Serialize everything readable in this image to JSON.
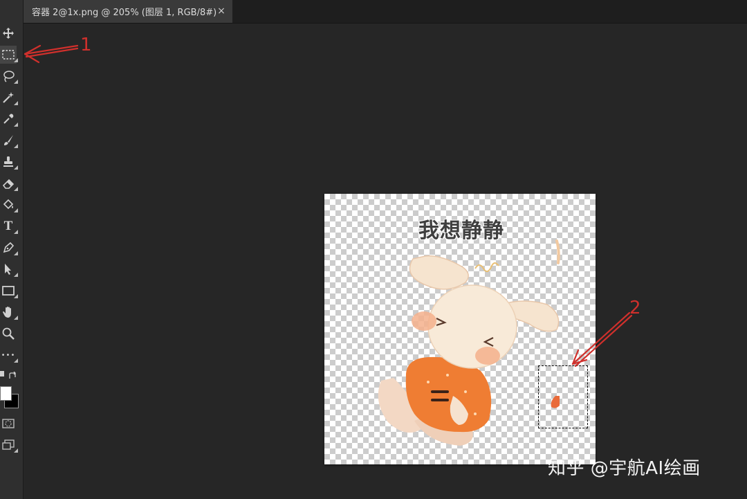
{
  "tab": {
    "title": "容器 2@1x.png @ 205% (图层 1, RGB/8#)",
    "close_glyph": "×"
  },
  "tools": [
    {
      "name": "move-tool",
      "icon": "move-icon"
    },
    {
      "name": "marquee-tool",
      "icon": "rectangular-marquee-icon"
    },
    {
      "name": "lasso-tool",
      "icon": "lasso-icon"
    },
    {
      "name": "magic-wand-tool",
      "icon": "magic-wand-icon"
    },
    {
      "name": "eyedropper-tool",
      "icon": "eyedropper-icon"
    },
    {
      "name": "brush-tool",
      "icon": "brush-icon"
    },
    {
      "name": "stamp-tool",
      "icon": "clone-stamp-icon"
    },
    {
      "name": "eraser-tool",
      "icon": "eraser-icon"
    },
    {
      "name": "paint-bucket-tool",
      "icon": "paint-bucket-icon"
    },
    {
      "name": "type-tool",
      "icon": "type-icon",
      "label": "T"
    },
    {
      "name": "pen-tool",
      "icon": "pen-icon"
    },
    {
      "name": "path-selection-tool",
      "icon": "arrow-icon"
    },
    {
      "name": "rectangle-tool",
      "icon": "rectangle-icon"
    },
    {
      "name": "hand-tool",
      "icon": "hand-icon"
    },
    {
      "name": "zoom-tool",
      "icon": "zoom-icon"
    },
    {
      "name": "more-tools",
      "icon": "more-icon",
      "label": "•••"
    }
  ],
  "colors": {
    "foreground": "#ffffff",
    "background": "#000000",
    "annotation": "#d0302c"
  },
  "document": {
    "sticker_text": "我想静静"
  },
  "annotations": {
    "label_1": "1",
    "label_2": "2"
  },
  "watermark": "知乎 @宇航AI绘画"
}
